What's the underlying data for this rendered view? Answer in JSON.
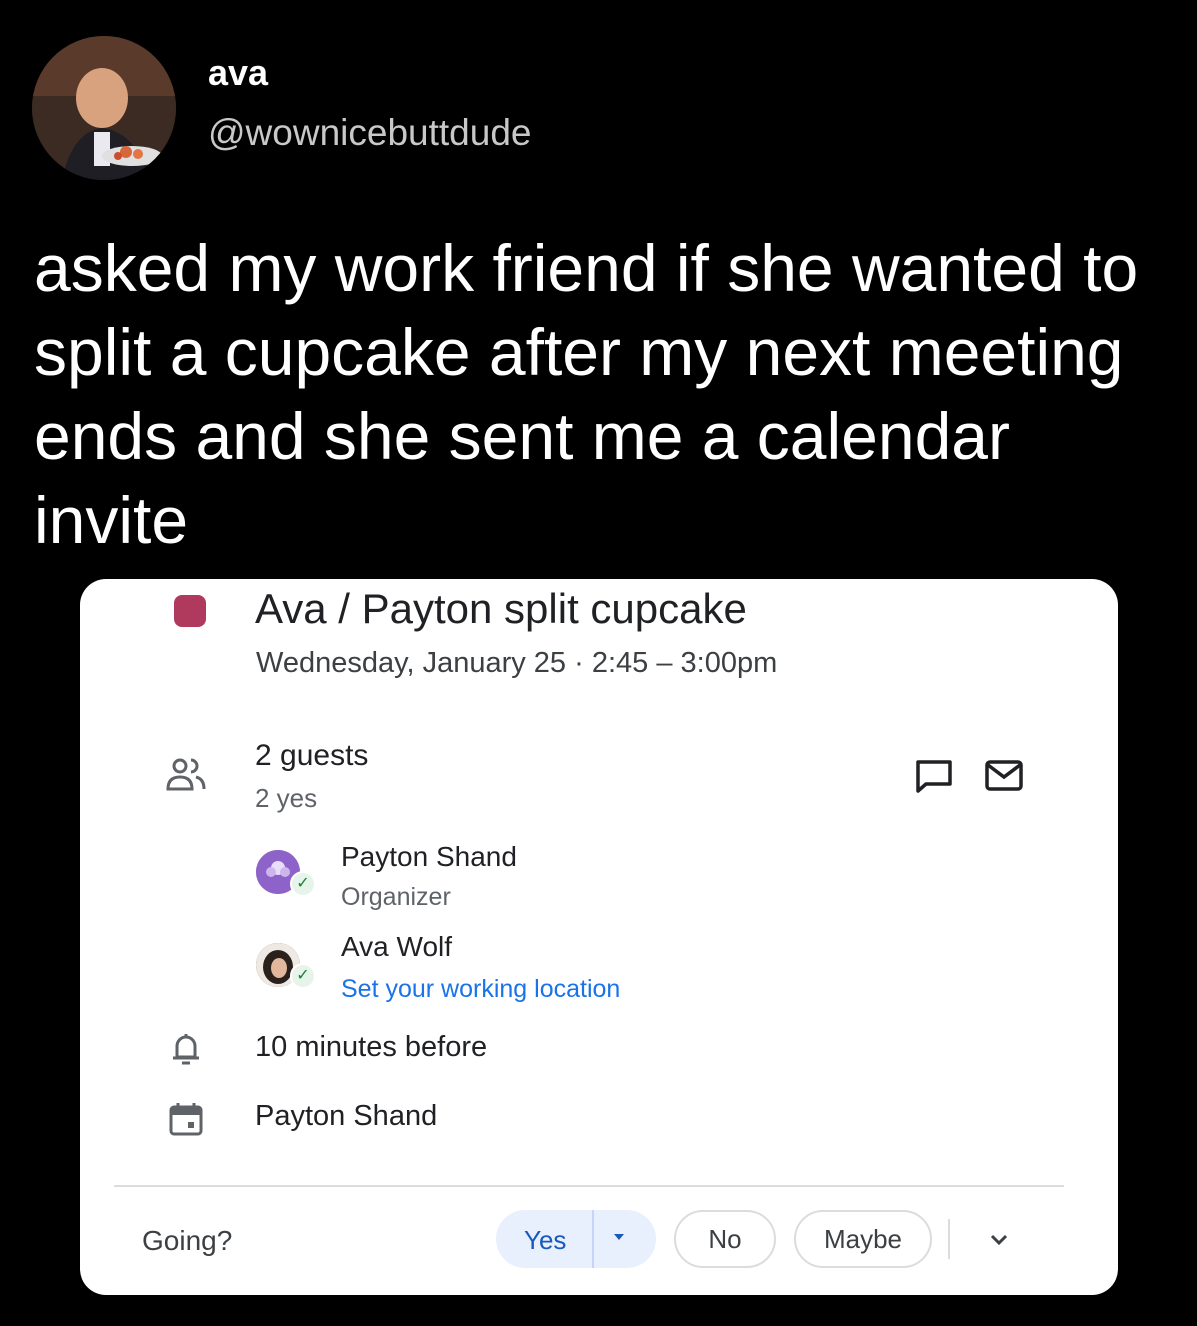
{
  "tweet": {
    "display_name": "ava",
    "handle": "@wownicebuttdude",
    "text": "asked my work friend if she wanted to split a cupcake after my next meeting ends and she sent me a calendar invite"
  },
  "event": {
    "color": "#b03a5e",
    "title": "Ava / Payton split cupcake",
    "when": "Wednesday, January 25  ·  2:45 – 3:00pm",
    "guests_count": "2 guests",
    "guests_yes": "2 yes",
    "guests": [
      {
        "name": "Payton Shand",
        "subtitle": "Organizer"
      },
      {
        "name": "Ava Wolf",
        "subtitle": "Set your working location"
      }
    ],
    "reminder": "10 minutes before",
    "calendar_owner": "Payton Shand"
  },
  "rsvp": {
    "prompt": "Going?",
    "yes": "Yes",
    "no": "No",
    "maybe": "Maybe"
  },
  "icons": [
    "guests-icon",
    "chat-icon",
    "mail-icon",
    "bell-icon",
    "calendar-icon",
    "check-icon",
    "chevron-down-icon"
  ]
}
